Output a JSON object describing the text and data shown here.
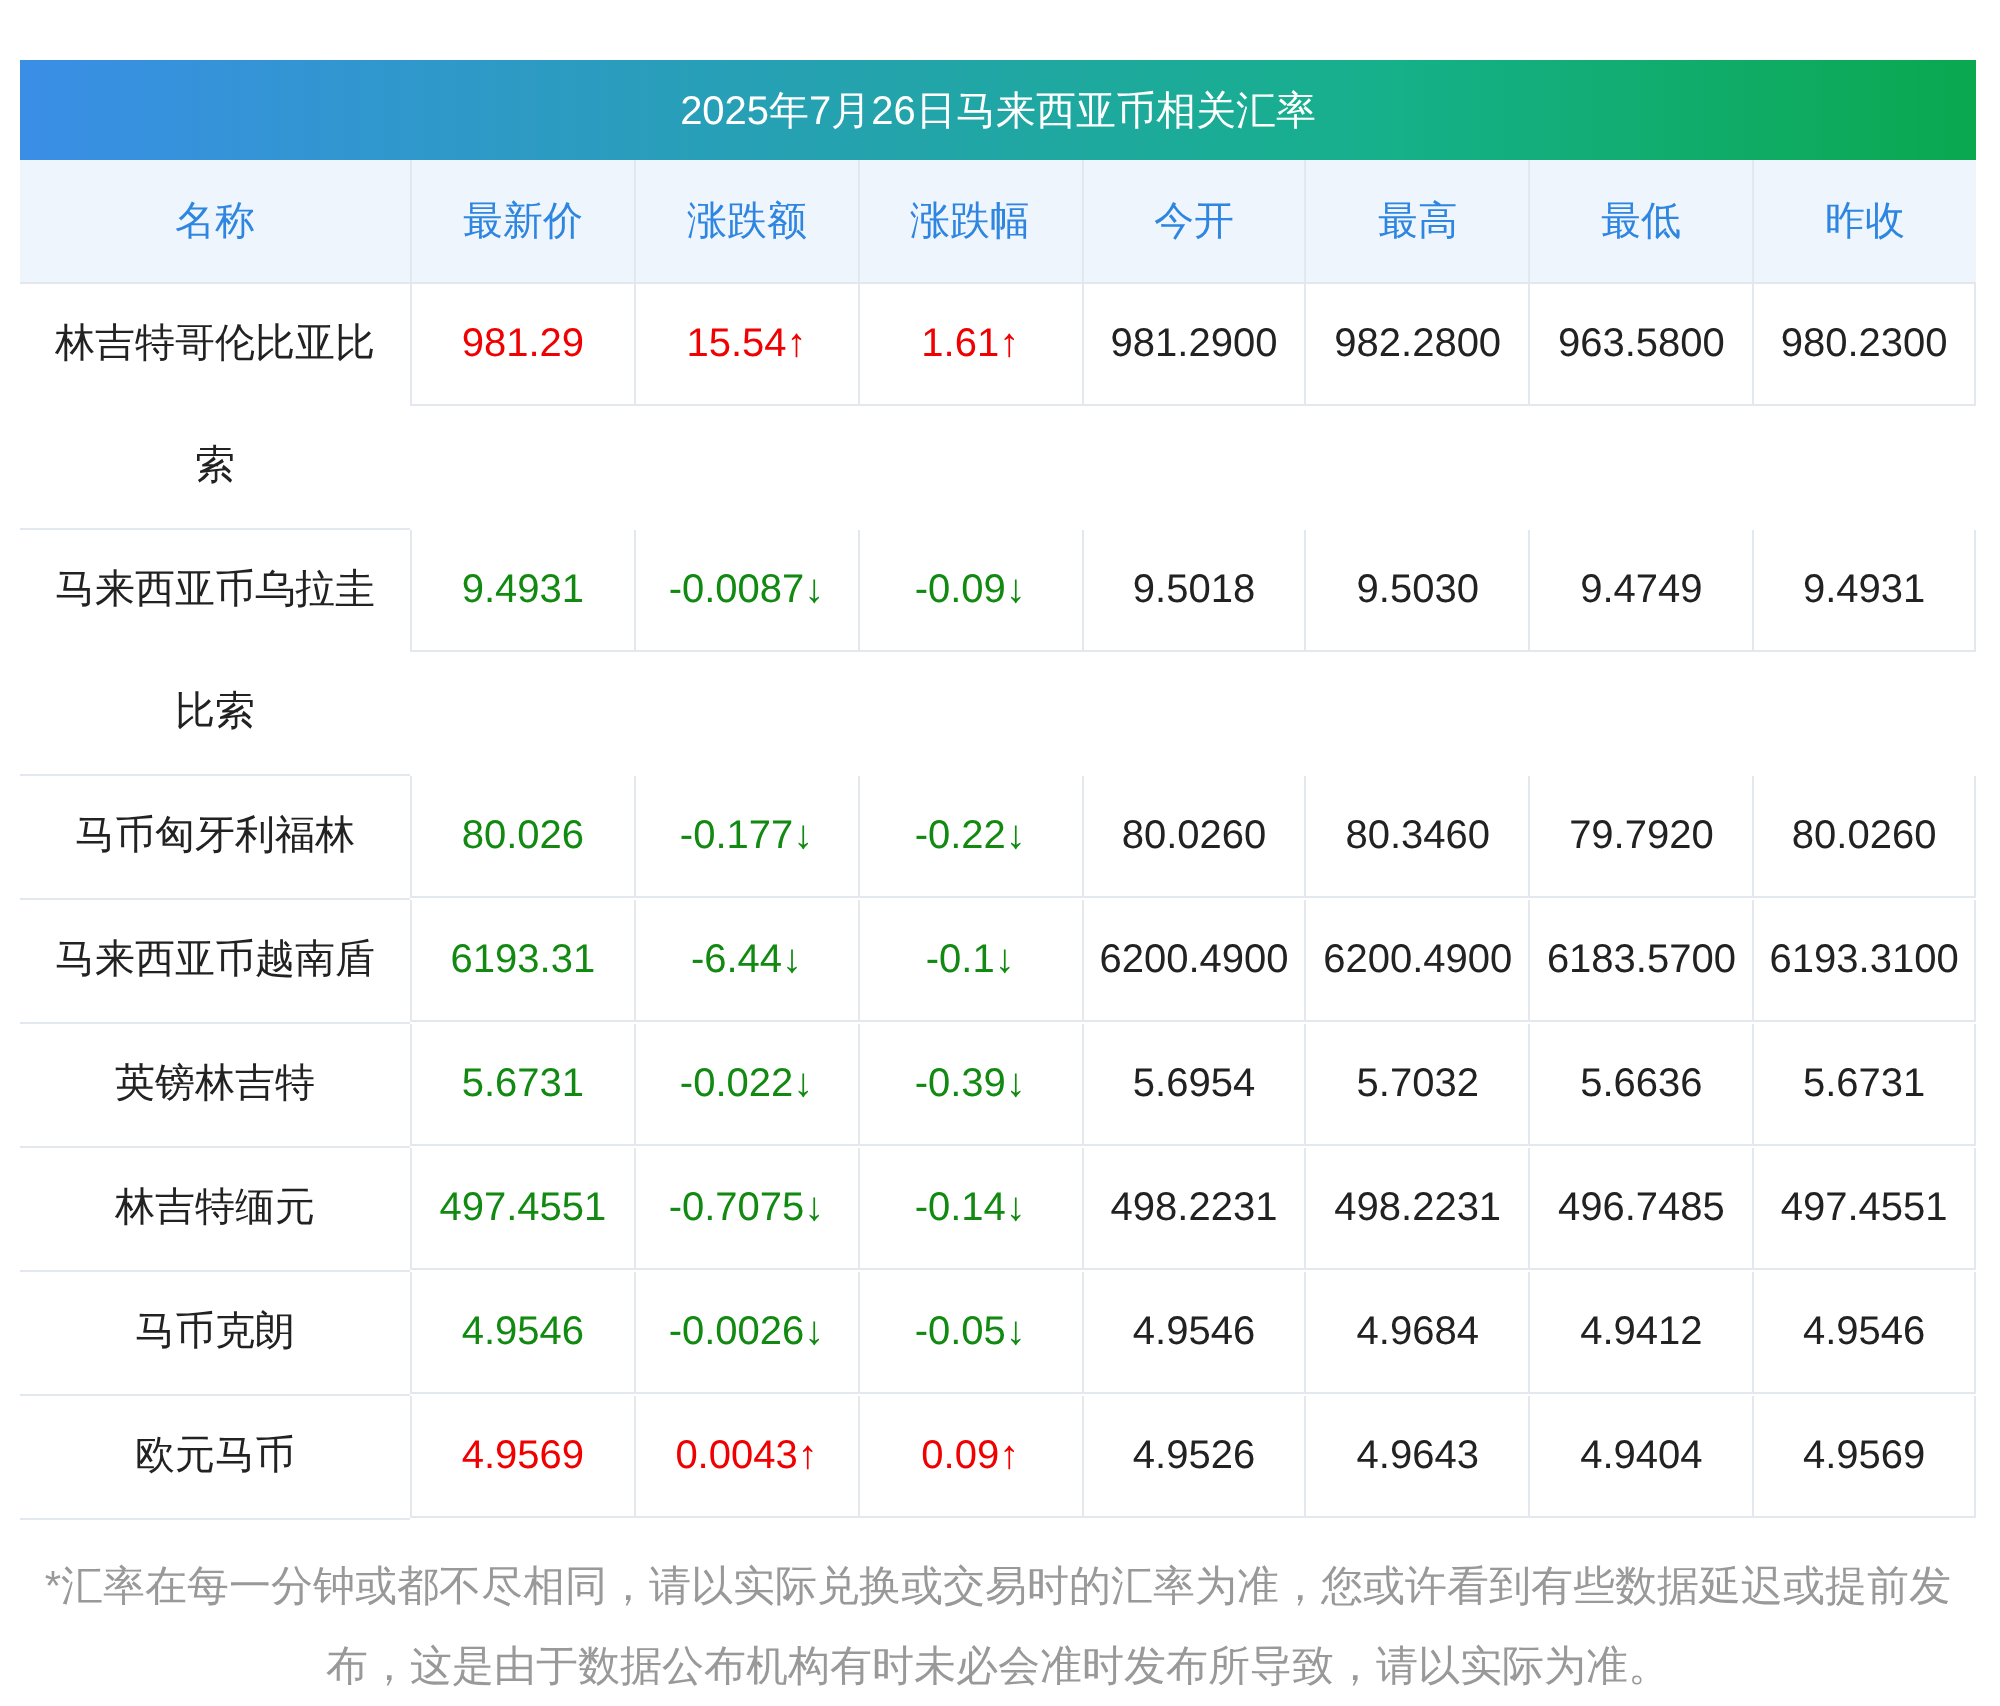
{
  "title": "2025年7月26日马来西亚币相关汇率",
  "columns": [
    "名称",
    "最新价",
    "涨跌额",
    "涨跌幅",
    "今开",
    "最高",
    "最低",
    "昨收"
  ],
  "rows": [
    {
      "name": "林吉特哥伦比亚比索",
      "kind": "up",
      "cells": [
        "981.29",
        "15.54↑",
        "1.61↑",
        "981.2900",
        "982.2800",
        "963.5800",
        "980.2300"
      ]
    },
    {
      "name": "马来西亚币乌拉圭比索",
      "kind": "down",
      "cells": [
        "9.4931",
        "-0.0087↓",
        "-0.09↓",
        "9.5018",
        "9.5030",
        "9.4749",
        "9.4931"
      ]
    },
    {
      "name": "马币匈牙利福林",
      "kind": "down",
      "cells": [
        "80.026",
        "-0.177↓",
        "-0.22↓",
        "80.0260",
        "80.3460",
        "79.7920",
        "80.0260"
      ]
    },
    {
      "name": "马来西亚币越南盾",
      "kind": "down",
      "cells": [
        "6193.31",
        "-6.44↓",
        "-0.1↓",
        "6200.4900",
        "6200.4900",
        "6183.5700",
        "6193.3100"
      ]
    },
    {
      "name": "英镑林吉特",
      "kind": "down",
      "cells": [
        "5.6731",
        "-0.022↓",
        "-0.39↓",
        "5.6954",
        "5.7032",
        "5.6636",
        "5.6731"
      ]
    },
    {
      "name": "林吉特缅元",
      "kind": "down",
      "cells": [
        "497.4551",
        "-0.7075↓",
        "-0.14↓",
        "498.2231",
        "498.2231",
        "496.7485",
        "497.4551"
      ]
    },
    {
      "name": "马币克朗",
      "kind": "down",
      "cells": [
        "4.9546",
        "-0.0026↓",
        "-0.05↓",
        "4.9546",
        "4.9684",
        "4.9412",
        "4.9546"
      ]
    },
    {
      "name": "欧元马币",
      "kind": "up",
      "cells": [
        "4.9569",
        "0.0043↑",
        "0.09↑",
        "4.9526",
        "4.9643",
        "4.9404",
        "4.9569"
      ]
    }
  ],
  "footnote": "*汇率在每一分钟或都不尽相同，请以实际兑换或交易时的汇率为准，您或许看到有些数据延迟或提前发布，这是由于数据公布机构有时未必会准时发布所导致，请以实际为准。"
}
